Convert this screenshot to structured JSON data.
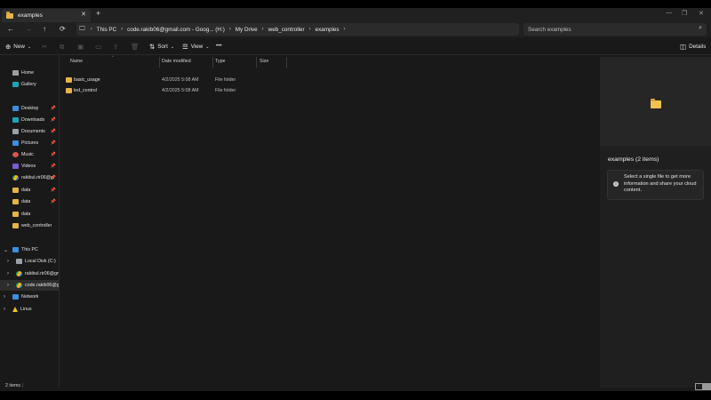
{
  "window": {
    "tab_title": "examples",
    "tab_close_icon": "close-icon",
    "new_tab_symbol": "+",
    "minimize_symbol": "—",
    "maximize_symbol": "❐",
    "close_symbol": "✕"
  },
  "nav": {
    "back": "←",
    "forward": "→",
    "up": "↑",
    "refresh": "⟳",
    "breadcrumb": [
      "This PC",
      "code.rakib06@gmail.com - Goog... (H:)",
      "My Drive",
      "web_controller",
      "examples"
    ],
    "search_placeholder": "Search examples"
  },
  "toolbar": {
    "new_label": "New",
    "sort_label": "Sort",
    "view_label": "View",
    "more_symbol": "•••",
    "details_label": "Details"
  },
  "sidebar": {
    "items": [
      {
        "label": "Home",
        "icon": "home-icon"
      },
      {
        "label": "Gallery",
        "icon": "gallery-icon"
      },
      {
        "label": "Desktop",
        "icon": "desktop-icon"
      },
      {
        "label": "Downloads",
        "icon": "downloads-icon"
      },
      {
        "label": "Documents",
        "icon": "documents-icon"
      },
      {
        "label": "Pictures",
        "icon": "pictures-icon"
      },
      {
        "label": "Music",
        "icon": "music-icon"
      },
      {
        "label": "Videos",
        "icon": "videos-icon"
      },
      {
        "label": "rakibul.rir06@gn",
        "icon": "google-drive-icon"
      },
      {
        "label": "data",
        "icon": "folder-icon"
      },
      {
        "label": "data",
        "icon": "folder-icon"
      },
      {
        "label": "data",
        "icon": "folder-icon"
      },
      {
        "label": "web_controller",
        "icon": "folder-icon"
      },
      {
        "label": "This PC",
        "icon": "computer-icon"
      },
      {
        "label": "Local Disk (C:)",
        "icon": "disk-icon"
      },
      {
        "label": "rakibul.rir06@gm",
        "icon": "google-drive-icon"
      },
      {
        "label": "code.rakib06@gm",
        "icon": "google-drive-icon"
      },
      {
        "label": "Network",
        "icon": "network-icon"
      },
      {
        "label": "Linux",
        "icon": "linux-icon"
      }
    ]
  },
  "columns": {
    "name": "Name",
    "date_modified": "Date modified",
    "type": "Type",
    "size": "Size"
  },
  "files": [
    {
      "name": "basic_usage",
      "date": "4/2/2025 5:08 AM",
      "type": "File folder",
      "size": ""
    },
    {
      "name": "led_control",
      "date": "4/2/2025 5:08 AM",
      "type": "File folder",
      "size": ""
    }
  ],
  "details_pane": {
    "title": "examples (2 items)",
    "info": "Select a single file to get more information and share your cloud content."
  },
  "status": {
    "items_count": "2 items",
    "separator": "|"
  },
  "colors": {
    "folder": "#e8b24a",
    "background": "#191919",
    "pane": "#1f1f1f"
  }
}
